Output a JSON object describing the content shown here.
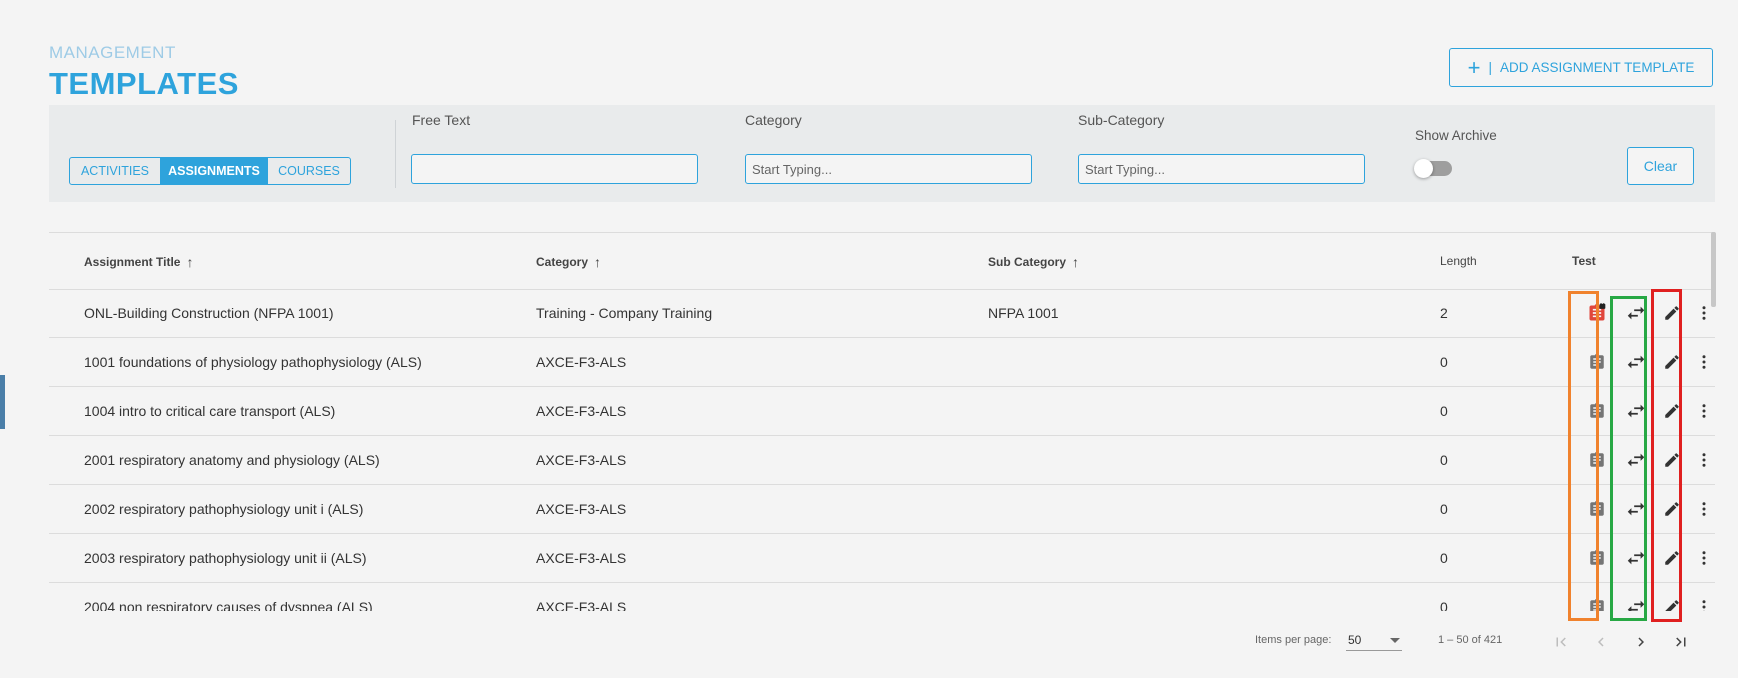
{
  "header": {
    "breadcrumb": "MANAGEMENT",
    "title": "TEMPLATES",
    "add_button_plus": "+",
    "add_button_separator": "|",
    "add_button_label": "ADD ASSIGNMENT TEMPLATE"
  },
  "filters": {
    "tabs": [
      {
        "label": "ACTIVITIES",
        "active": false
      },
      {
        "label": "ASSIGNMENTS",
        "active": true
      },
      {
        "label": "COURSES",
        "active": false
      }
    ],
    "free_text": {
      "label": "Free Text",
      "value": "",
      "placeholder": ""
    },
    "category": {
      "label": "Category",
      "value": "",
      "placeholder": "Start Typing..."
    },
    "sub_category": {
      "label": "Sub-Category",
      "value": "",
      "placeholder": "Start Typing..."
    },
    "show_archive": {
      "label": "Show Archive",
      "on": false
    },
    "clear_label": "Clear"
  },
  "table": {
    "columns": [
      {
        "label": "Assignment Title",
        "arrow": "↑"
      },
      {
        "label": "Category",
        "arrow": "↑"
      },
      {
        "label": "Sub Category",
        "arrow": "↑"
      },
      {
        "label": "Length",
        "arrow": ""
      },
      {
        "label": "Test",
        "arrow": ""
      }
    ],
    "rows": [
      {
        "title": "ONL-Building Construction (NFPA 1001)",
        "category": "Training - Company Training",
        "sub_category": "NFPA 1001",
        "length": "2",
        "test_icon": "assignment-locked-icon"
      },
      {
        "title": "1001 foundations of physiology pathophysiology (ALS)",
        "category": "AXCE-F3-ALS",
        "sub_category": "",
        "length": "0",
        "test_icon": "assignment-icon"
      },
      {
        "title": "1004 intro to critical care transport (ALS)",
        "category": "AXCE-F3-ALS",
        "sub_category": "",
        "length": "0",
        "test_icon": "assignment-icon"
      },
      {
        "title": "2001 respiratory anatomy and physiology (ALS)",
        "category": "AXCE-F3-ALS",
        "sub_category": "",
        "length": "0",
        "test_icon": "assignment-icon"
      },
      {
        "title": "2002 respiratory pathophysiology unit i (ALS)",
        "category": "AXCE-F3-ALS",
        "sub_category": "",
        "length": "0",
        "test_icon": "assignment-icon"
      },
      {
        "title": "2003 respiratory pathophysiology unit ii (ALS)",
        "category": "AXCE-F3-ALS",
        "sub_category": "",
        "length": "0",
        "test_icon": "assignment-icon"
      },
      {
        "title": "2004 non respiratory causes of dyspnea (ALS)",
        "category": "AXCE-F3-ALS",
        "sub_category": "",
        "length": "0",
        "test_icon": "assignment-icon"
      }
    ]
  },
  "pagination": {
    "items_per_page_label": "Items per page:",
    "items_per_page": "50",
    "range": "1 – 50 of 421"
  },
  "colors": {
    "accent": "#2ea3dc",
    "highlight_orange": "#f0822d",
    "highlight_green": "#27a844",
    "highlight_red": "#e02020",
    "locked_icon": "#e0463c"
  }
}
